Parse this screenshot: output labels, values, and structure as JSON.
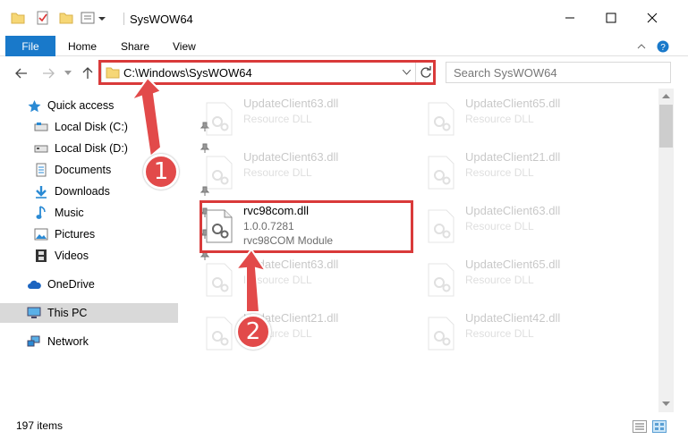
{
  "window": {
    "title": "SysWOW64"
  },
  "ribbon": {
    "file": "File",
    "home": "Home",
    "share": "Share",
    "view": "View"
  },
  "address": {
    "path": "C:\\Windows\\SysWOW64",
    "search_placeholder": "Search SysWOW64"
  },
  "sidebar": {
    "items": [
      {
        "label": "Quick access"
      },
      {
        "label": "Local Disk (C:)"
      },
      {
        "label": "Local Disk (D:)"
      },
      {
        "label": "Documents"
      },
      {
        "label": "Downloads"
      },
      {
        "label": "Music"
      },
      {
        "label": "Pictures"
      },
      {
        "label": "Videos"
      },
      {
        "label": "OneDrive"
      },
      {
        "label": "This PC"
      },
      {
        "label": "Network"
      }
    ]
  },
  "files": [
    {
      "name": "UpdateClient63.dll",
      "desc": "Resource DLL"
    },
    {
      "name": "UpdateClient65.dll",
      "desc": "Resource DLL"
    },
    {
      "name": "UpdateClient63.dll",
      "desc": "Resource DLL"
    },
    {
      "name": "UpdateClient21.dll",
      "desc": "Resource DLL"
    },
    {
      "name": "rvc98com.dll",
      "version": "1.0.0.7281",
      "desc": "rvc98COM Module"
    },
    {
      "name": "UpdateClient63.dll",
      "desc": "Resource DLL"
    },
    {
      "name": "UpdateClient63.dll",
      "desc": "Resource DLL"
    },
    {
      "name": "UpdateClient65.dll",
      "desc": "Resource DLL"
    },
    {
      "name": "UpdateClient21.dll",
      "desc": "Resource DLL"
    },
    {
      "name": "UpdateClient42.dll",
      "desc": "Resource DLL"
    }
  ],
  "status": {
    "count": "197 items"
  },
  "annotations": {
    "step1": "1",
    "step2": "2"
  },
  "colors": {
    "accent": "#1979ca",
    "highlight": "#d93a3a",
    "badge": "#e24a4a"
  }
}
